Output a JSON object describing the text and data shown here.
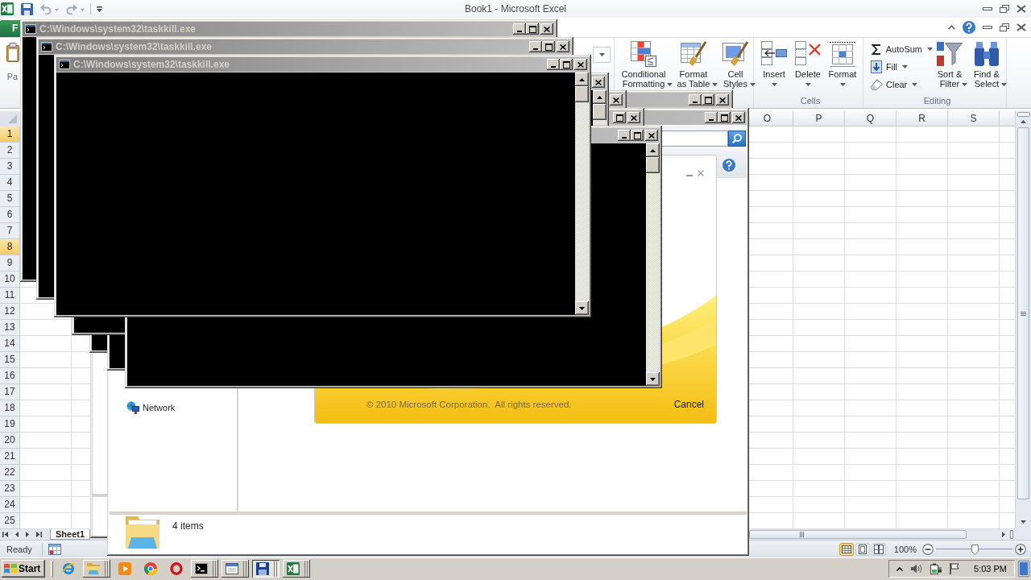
{
  "excel": {
    "title": "Book1 - Microsoft Excel",
    "quick_access": [
      {
        "kind": "save",
        "disabled": false
      },
      {
        "kind": "undo",
        "disabled": true
      },
      {
        "kind": "redo",
        "disabled": true
      }
    ],
    "file_tab": "F",
    "paste_label": "Pa",
    "styles": [
      {
        "label": "Conditional Formatting"
      },
      {
        "label": "Format as Table"
      },
      {
        "label": "Cell Styles"
      }
    ],
    "cells": {
      "buttons": [
        {
          "label": "Insert"
        },
        {
          "label": "Delete"
        },
        {
          "label": "Format"
        }
      ],
      "group": "Cells"
    },
    "editing": {
      "small": [
        {
          "label": "AutoSum"
        },
        {
          "label": "Fill"
        },
        {
          "label": "Clear"
        }
      ],
      "large": [
        {
          "label": "Sort & Filter"
        },
        {
          "label": "Find & Select"
        }
      ],
      "group": "Editing"
    },
    "columns": [
      "O",
      "P",
      "Q",
      "R",
      "S"
    ],
    "rows": [
      {
        "label": "1",
        "selected": true
      },
      {
        "label": "2",
        "selected": false
      },
      {
        "label": "3",
        "selected": false
      },
      {
        "label": "4",
        "selected": false
      },
      {
        "label": "5",
        "selected": false
      },
      {
        "label": "6",
        "selected": false
      },
      {
        "label": "7",
        "selected": false
      },
      {
        "label": "8",
        "selected": true
      },
      {
        "label": "9",
        "selected": false
      },
      {
        "label": "10",
        "selected": false
      },
      {
        "label": "11",
        "selected": false
      },
      {
        "label": "12",
        "selected": false
      },
      {
        "label": "13",
        "selected": false
      },
      {
        "label": "14",
        "selected": false
      },
      {
        "label": "15",
        "selected": false
      },
      {
        "label": "16",
        "selected": false
      },
      {
        "label": "17",
        "selected": false
      },
      {
        "label": "18",
        "selected": false
      },
      {
        "label": "19",
        "selected": false
      },
      {
        "label": "20",
        "selected": false
      },
      {
        "label": "21",
        "selected": false
      },
      {
        "label": "22",
        "selected": false
      },
      {
        "label": "23",
        "selected": false
      },
      {
        "label": "24",
        "selected": false
      },
      {
        "label": "25",
        "selected": false
      }
    ],
    "sheet_tab": "Sheet1",
    "status": "Ready",
    "views": [
      {
        "kind": "normal",
        "selected": true
      },
      {
        "kind": "layout",
        "selected": false
      },
      {
        "kind": "breaks",
        "selected": false
      }
    ],
    "zoom": {
      "reading": "100%",
      "level": 0.5
    }
  },
  "background_window": {
    "active": false
  },
  "explorer": {
    "active": false,
    "nav_items": [
      {
        "label": "Network"
      }
    ],
    "status": "4 items"
  },
  "splash": {
    "copyright": "© 2010 Microsoft Corporation.  All rights reserved.",
    "cancel": "Cancel"
  },
  "consoles": [
    {
      "title": "C:\\Windows\\system32\\taskkill.exe",
      "active": false
    },
    {
      "title": "C:\\Windows\\system32\\taskkill.exe",
      "active": false
    },
    {
      "title": "C:\\Windows\\system32\\taskkill.exe",
      "active": false
    },
    {
      "active": false
    },
    {
      "active": false
    },
    {
      "active": false
    },
    {
      "active": false
    }
  ],
  "taskbar": {
    "start": "Start",
    "tasks": [
      {
        "kind": "globe",
        "stacked": false,
        "selected": false
      },
      {
        "kind": "folder",
        "stacked": true,
        "selected": false
      },
      {
        "kind": "play",
        "stacked": false,
        "selected": false
      },
      {
        "kind": "ball",
        "stacked": false,
        "selected": false
      },
      {
        "kind": "ring",
        "stacked": false,
        "selected": false
      },
      {
        "kind": "console",
        "stacked": true,
        "selected": false
      },
      {
        "kind": "window",
        "stacked": true,
        "selected": false
      },
      {
        "kind": "disk",
        "stacked": true,
        "selected": true
      },
      {
        "kind": "sheet",
        "stacked": true,
        "selected": false
      }
    ],
    "clock": "5:03 PM"
  }
}
